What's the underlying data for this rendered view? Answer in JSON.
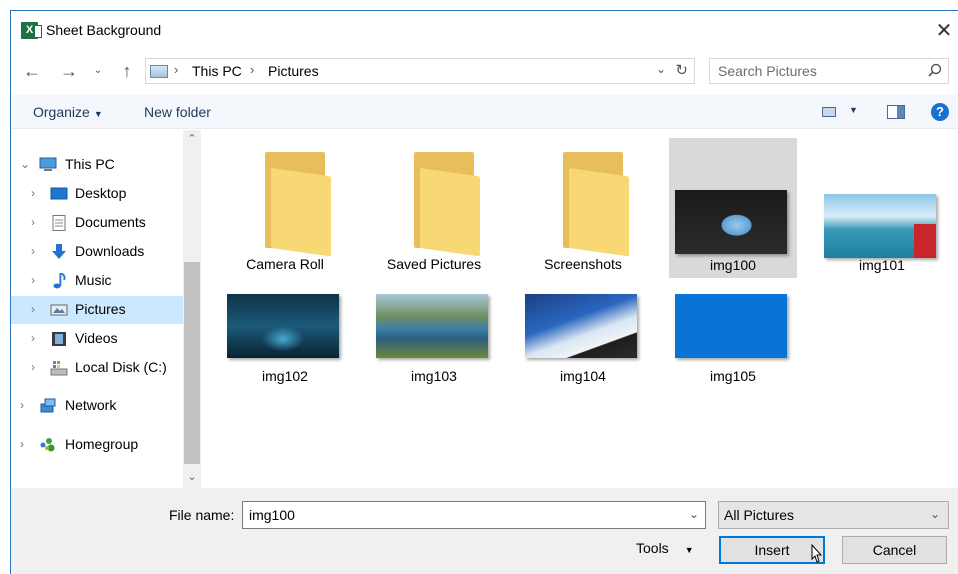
{
  "window": {
    "title": "Sheet Background",
    "app_icon": "excel-icon",
    "close_glyph": "✕"
  },
  "nav": {
    "back_glyph": "←",
    "forward_glyph": "→",
    "recent_glyph": "⌄",
    "up_glyph": "↑",
    "breadcrumb": [
      "This PC",
      "Pictures"
    ],
    "separator": "›",
    "dropdown_glyph": "⌄",
    "refresh_glyph": "↻",
    "search_placeholder": "Search Pictures"
  },
  "toolbar": {
    "organize": "Organize",
    "new_folder": "New folder",
    "caret": "▼",
    "help_glyph": "?"
  },
  "sidebar": {
    "scroll_up": "⌃",
    "scroll_down": "⌄",
    "items": [
      {
        "label": "This PC",
        "icon": "computer-icon",
        "chevron": "⌄"
      },
      {
        "label": "Desktop",
        "icon": "desktop-icon",
        "chevron": "›"
      },
      {
        "label": "Documents",
        "icon": "documents-icon",
        "chevron": "›"
      },
      {
        "label": "Downloads",
        "icon": "downloads-icon",
        "chevron": "›"
      },
      {
        "label": "Music",
        "icon": "music-icon",
        "chevron": "›"
      },
      {
        "label": "Pictures",
        "icon": "pictures-icon",
        "chevron": "›",
        "selected": true
      },
      {
        "label": "Videos",
        "icon": "videos-icon",
        "chevron": "›"
      },
      {
        "label": "Local Disk (C:)",
        "icon": "disk-icon",
        "chevron": "›"
      },
      {
        "label": "Network",
        "icon": "network-icon",
        "chevron": "›"
      },
      {
        "label": "Homegroup",
        "icon": "homegroup-icon",
        "chevron": "›"
      }
    ]
  },
  "files": [
    {
      "name": "Camera Roll",
      "kind": "folder"
    },
    {
      "name": "Saved Pictures",
      "kind": "folder"
    },
    {
      "name": "Screenshots",
      "kind": "folder"
    },
    {
      "name": "img100",
      "kind": "image",
      "selected": true
    },
    {
      "name": "img101",
      "kind": "image"
    },
    {
      "name": "img102",
      "kind": "image"
    },
    {
      "name": "img103",
      "kind": "image"
    },
    {
      "name": "img104",
      "kind": "image"
    },
    {
      "name": "img105",
      "kind": "image"
    }
  ],
  "footer": {
    "file_name_label": "File name:",
    "file_name_value": "img100",
    "dropdown_glyph": "⌄",
    "filter": "All Pictures",
    "tools": "Tools",
    "tools_caret": "▼",
    "insert": "Insert",
    "cancel": "Cancel"
  },
  "colors": {
    "accent": "#0078d7",
    "selection": "#cce8ff",
    "tile_selection": "#d9d9d9",
    "folder": "#f8d775"
  }
}
